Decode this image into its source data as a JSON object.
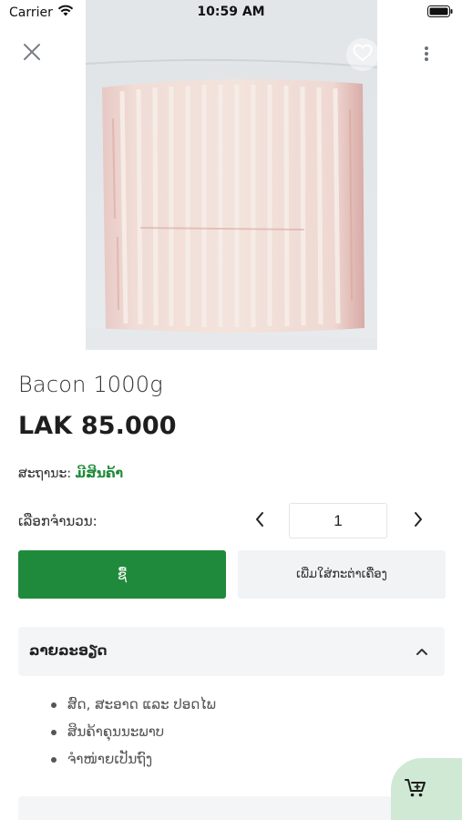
{
  "status_bar": {
    "carrier": "Carrier",
    "time": "10:59 AM"
  },
  "product": {
    "name": "Bacon 1000g",
    "price": "LAK 85.000",
    "status_label": "ສະຖານະ:",
    "status_value": "ມີສິນຄ້າ",
    "status_color": "#1f8a3b"
  },
  "quantity": {
    "label": "ເລືອກຈຳນວນ:",
    "value": "1"
  },
  "actions": {
    "buy_label": "ຊື້",
    "add_to_cart_label": "ເພີ່ມໃສ່ກະຕ່າເຄື່ອງ",
    "buy_color": "#1f8a3b"
  },
  "details": {
    "title": "ລາຍລະອຽດ",
    "items": [
      "ສົດ, ສະອາດ ແລະ ປອດໄພ",
      "ສິນຄ້າຄຸນນະພາບ",
      "ຈຳໜ່າຍເປັນຖົງ"
    ]
  },
  "icons": {
    "close": "close-icon",
    "favorite": "heart-icon",
    "more": "more-vertical-icon",
    "minus": "chevron-left-icon",
    "plus": "chevron-right-icon",
    "collapse": "chevron-up-icon",
    "cart": "cart-add-icon"
  }
}
